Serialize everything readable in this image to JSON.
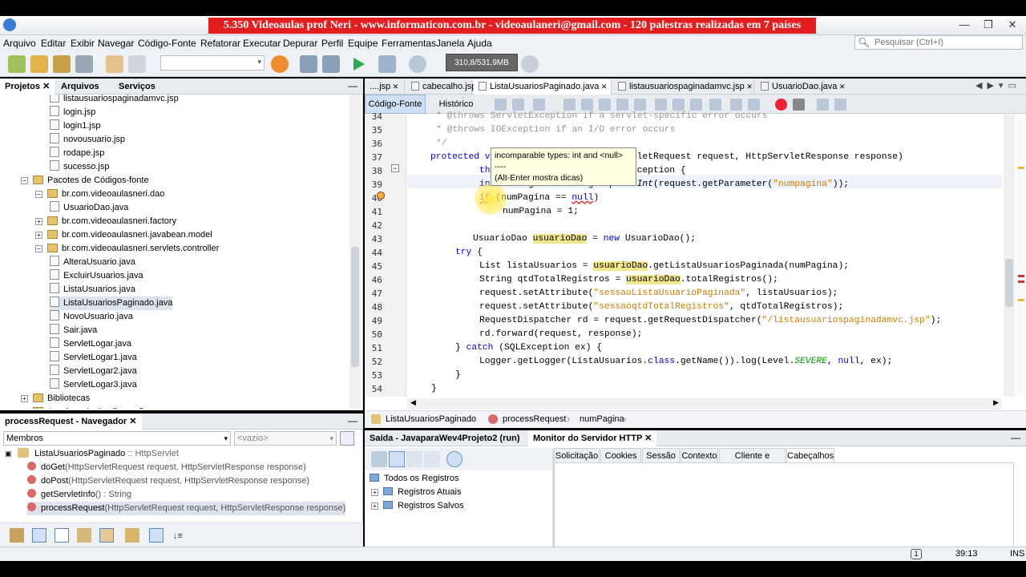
{
  "banner": "5.350 Videoaulas prof Neri - www.informaticon.com.br - videoaulaneri@gmail.com - 120 palestras realizadas em 7 países",
  "menu": [
    "Arquivo",
    "Editar",
    "Exibir",
    "Navegar",
    "Código-Fonte",
    "Refatorar",
    "Executar",
    "Depurar",
    "Perfil",
    "Equipe",
    "Ferramentas",
    "Janela",
    "Ajuda"
  ],
  "search_placeholder": "Pesquisar (Ctrl+I)",
  "memory": "310,8/531,9MB",
  "left_tabs": [
    "Projetos",
    "Arquivos",
    "Serviços"
  ],
  "tree": [
    {
      "label": "listausuariospaginadamvc.jsp",
      "indent": 3,
      "type": "file"
    },
    {
      "label": "login.jsp",
      "indent": 3,
      "type": "file"
    },
    {
      "label": "login1.jsp",
      "indent": 3,
      "type": "file"
    },
    {
      "label": "novousuario.jsp",
      "indent": 3,
      "type": "file"
    },
    {
      "label": "rodape.jsp",
      "indent": 3,
      "type": "file"
    },
    {
      "label": "sucesso.jsp",
      "indent": 3,
      "type": "file"
    },
    {
      "label": "Pacotes de Códigos-fonte",
      "indent": 1,
      "type": "pkg",
      "exp": "−"
    },
    {
      "label": "br.com.videoaulasneri.dao",
      "indent": 2,
      "type": "pkg",
      "exp": "−"
    },
    {
      "label": "UsuarioDao.java",
      "indent": 3,
      "type": "file"
    },
    {
      "label": "br.com.videoaulasneri.factory",
      "indent": 2,
      "type": "pkg",
      "exp": "+"
    },
    {
      "label": "br.com.videoaulasneri.javabean.model",
      "indent": 2,
      "type": "pkg",
      "exp": "+"
    },
    {
      "label": "br.com.videoaulasneri.servlets.controller",
      "indent": 2,
      "type": "pkg",
      "exp": "−"
    },
    {
      "label": "AlteraUsuario.java",
      "indent": 3,
      "type": "file"
    },
    {
      "label": "ExcluirUsuarios.java",
      "indent": 3,
      "type": "file"
    },
    {
      "label": "ListaUsuarios.java",
      "indent": 3,
      "type": "file"
    },
    {
      "label": "ListaUsuariosPaginado.java",
      "indent": 3,
      "type": "file",
      "selected": true
    },
    {
      "label": "NovoUsuario.java",
      "indent": 3,
      "type": "file"
    },
    {
      "label": "Sair.java",
      "indent": 3,
      "type": "file"
    },
    {
      "label": "ServletLogar.java",
      "indent": 3,
      "type": "file"
    },
    {
      "label": "ServletLogar1.java",
      "indent": 3,
      "type": "file"
    },
    {
      "label": "ServletLogar2.java",
      "indent": 3,
      "type": "file"
    },
    {
      "label": "ServletLogar3.java",
      "indent": 3,
      "type": "file"
    },
    {
      "label": "Bibliotecas",
      "indent": 1,
      "type": "pkg",
      "exp": "+"
    },
    {
      "label": "Arquivos de Configuração",
      "indent": 1,
      "type": "pkg",
      "exp": "+"
    }
  ],
  "navigator": {
    "title": "processRequest - Navegador",
    "members_label": "Membros",
    "empty_label": "<vazio>",
    "class_name": "ListaUsuariosPaginado",
    "class_super": " :: HttpServlet",
    "methods": [
      {
        "name": "doGet",
        "sig": "(HttpServletRequest request, HttpServletResponse response)"
      },
      {
        "name": "doPost",
        "sig": "(HttpServletRequest request, HttpServletResponse response)"
      },
      {
        "name": "getServletInfo",
        "sig": "() : String"
      },
      {
        "name": "processRequest",
        "sig": "(HttpServletRequest request, HttpServletResponse response)"
      }
    ]
  },
  "editor_tabs": [
    "....jsp",
    "cabecalho.jsp",
    "ListaUsuariosPaginado.java",
    "listausuariospaginadamvc.jsp",
    "UsuarioDao.java"
  ],
  "editor_subtabs": [
    "Código-Fonte",
    "Histórico"
  ],
  "line_numbers": [
    "34",
    "35",
    "36",
    "37",
    "38",
    "39",
    "40",
    "41",
    "42",
    "43",
    "44",
    "45",
    "46",
    "47",
    "48",
    "49",
    "50",
    "51",
    "52",
    "53",
    "54"
  ],
  "tooltip": {
    "line1": "incomparable types: int and <null>",
    "line2": "----",
    "line3": "(Alt-Enter mostra dicas)"
  },
  "breadcrumbs": [
    "ListaUsuariosPaginado",
    "processRequest",
    "numPagina"
  ],
  "output_tabs": [
    "Saída - JavaparaWev4Projeto2 (run)",
    "Monitor do Servidor HTTP"
  ],
  "monitor_tree": [
    "Todos os Registros",
    "Registros Atuais",
    "Registros Salvos"
  ],
  "monitor_tabs": [
    "Solicitação",
    "Cookies",
    "Sessão",
    "Contexto",
    "Cliente e Servidor",
    "Cabeçalhos"
  ],
  "status": {
    "position": "39:13",
    "mode": "INS",
    "notification": "1"
  }
}
